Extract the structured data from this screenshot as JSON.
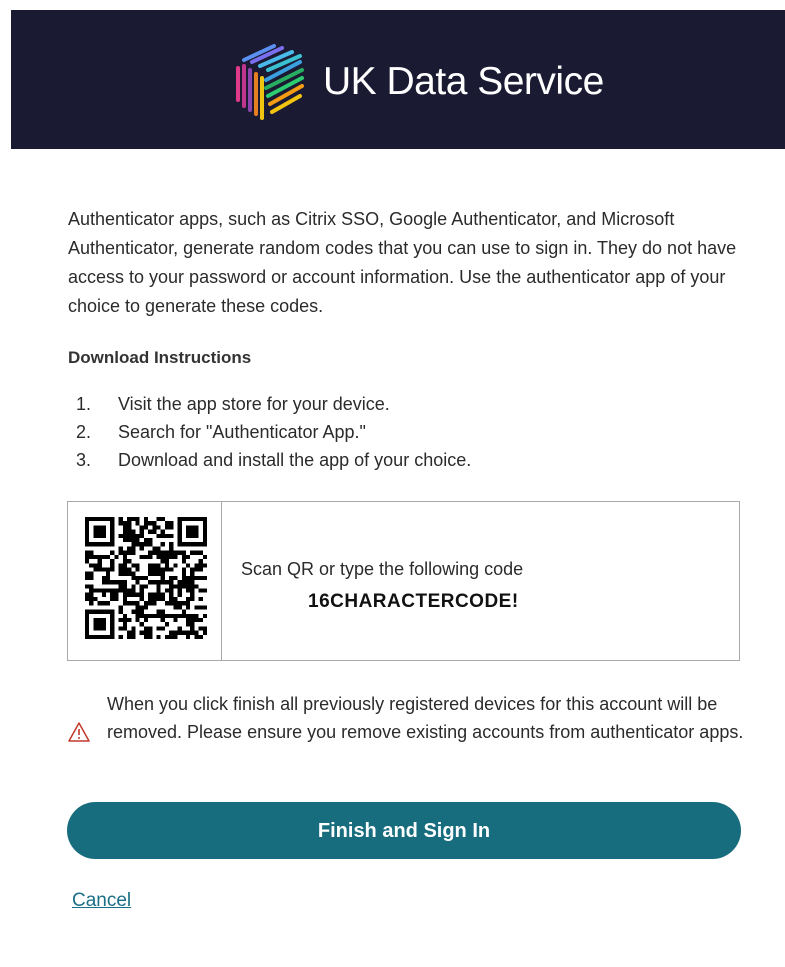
{
  "header": {
    "logo_text": "UK Data Service",
    "logo_icon": "ukds-logo-cube-icon"
  },
  "intro": {
    "text": "Authenticator apps, such as Citrix SSO, Google Authenticator, and Microsoft Authenticator, generate random codes that you can use to sign in. They do not have access to your password or account information. Use the authenticator app of your choice to generate these codes."
  },
  "download": {
    "heading": "Download Instructions",
    "steps": [
      {
        "num": "1.",
        "text": "Visit the app store for your device."
      },
      {
        "num": "2.",
        "text": "Search for \"Authenticator App.\""
      },
      {
        "num": "3.",
        "text": "Download and install the app of your choice."
      }
    ]
  },
  "qr": {
    "icon": "qr-code-icon",
    "instruction": "Scan QR or type the following code",
    "code": "16CHARACTERCODE!"
  },
  "warning": {
    "icon": "warning-triangle-icon",
    "text": "When you click finish all previously registered devices for this account will be removed. Please ensure you remove existing accounts from authenticator apps."
  },
  "actions": {
    "finish_label": "Finish and Sign In",
    "cancel_label": "Cancel"
  },
  "colors": {
    "banner": "#1b1a33",
    "button": "#176d7d",
    "link": "#1a6e86",
    "warning": "#c0392b"
  }
}
